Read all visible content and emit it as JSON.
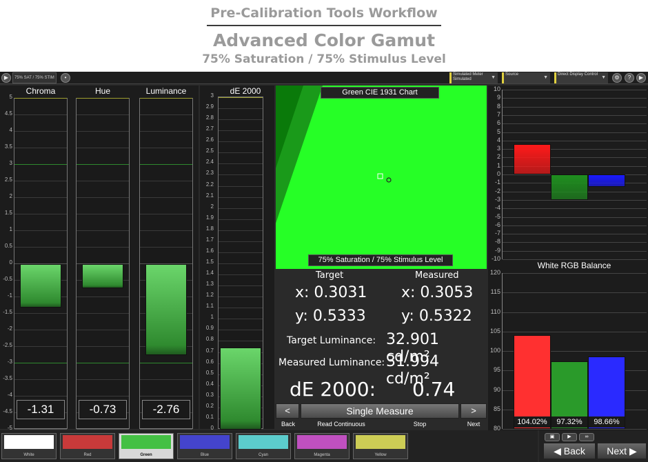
{
  "header": {
    "title": "Pre-Calibration Tools Workflow",
    "subtitle": "Advanced Color Gamut",
    "subtitle2": "75% Saturation / 75% Stimulus Level"
  },
  "toolbar": {
    "pattern_label": "75% SAT / 75% STIM",
    "meter_label": "Simulated Meter\nSimulated",
    "source_label": "Source",
    "display_label": "Direct Display Control"
  },
  "colors": {
    "accent_green": "#26ff26",
    "red": "#ff2a2a",
    "green": "#2f9a2f",
    "blue": "#2626ff"
  },
  "left_chart": {
    "ticks": [
      "5",
      "4.5",
      "4",
      "3.5",
      "3",
      "2.5",
      "2",
      "1.5",
      "1",
      "0.5",
      "0",
      "-0.5",
      "-1",
      "-1.5",
      "-2",
      "-2.5",
      "-3",
      "-3.5",
      "-4",
      "-4.5",
      "-5"
    ],
    "columns": [
      {
        "title": "Chroma",
        "value": -1.31,
        "label": "-1.31"
      },
      {
        "title": "Hue",
        "value": -0.73,
        "label": "-0.73"
      },
      {
        "title": "Luminance",
        "value": -2.76,
        "label": "-2.76"
      }
    ]
  },
  "de_chart": {
    "title": "dE 2000",
    "ticks": [
      "3",
      "2.9",
      "2.8",
      "2.7",
      "2.6",
      "2.5",
      "2.4",
      "2.3",
      "2.2",
      "2.1",
      "2",
      "1.9",
      "1.8",
      "1.7",
      "1.6",
      "1.5",
      "1.4",
      "1.3",
      "1.2",
      "1.1",
      "1",
      "0.9",
      "0.8",
      "0.7",
      "0.6",
      "0.5",
      "0.4",
      "0.3",
      "0.2",
      "0.1",
      "0"
    ],
    "value": 0.74
  },
  "cie": {
    "title": "Green CIE 1931 Chart",
    "caption": "75% Saturation / 75% Stimulus Level"
  },
  "readings": {
    "target_header": "Target",
    "measured_header": "Measured",
    "target_x": "x: 0.3031",
    "measured_x": "x: 0.3053",
    "target_y": "y: 0.5333",
    "measured_y": "y: 0.5322",
    "target_lum_label": "Target Luminance:",
    "target_lum_value": "32.901 cd/m²",
    "measured_lum_label": "Measured Luminance:",
    "measured_lum_value": "31.994 cd/m²",
    "de_label": "dE 2000:",
    "de_value": "0.74"
  },
  "controls": {
    "prev_symbol": "<",
    "next_symbol": ">",
    "single_measure": "Single Measure",
    "back": "Back",
    "read_continuous": "Read Continuous",
    "stop": "Stop",
    "next": "Next"
  },
  "rgb_chart": {
    "ticks": [
      "10",
      "9",
      "8",
      "7",
      "6",
      "5",
      "4",
      "3",
      "2",
      "1",
      "0",
      "-1",
      "-2",
      "-3",
      "-4",
      "-5",
      "-6",
      "-7",
      "-8",
      "-9",
      "-10"
    ],
    "values": {
      "red": 3.6,
      "green": -3.0,
      "blue": -1.5
    }
  },
  "balance_chart": {
    "title": "White RGB Balance",
    "ticks": [
      "120",
      "115",
      "110",
      "105",
      "100",
      "95",
      "90",
      "85",
      "80"
    ],
    "bars": [
      {
        "name": "red",
        "value": 104.02,
        "label": "104.02%"
      },
      {
        "name": "green",
        "value": 97.32,
        "label": "97.32%"
      },
      {
        "name": "blue",
        "value": 98.66,
        "label": "98.66%"
      }
    ]
  },
  "swatches": [
    {
      "label": "White",
      "color": "#ffffff"
    },
    {
      "label": "Red",
      "color": "#c83a3a"
    },
    {
      "label": "Green",
      "color": "#44c044",
      "selected": true
    },
    {
      "label": "Blue",
      "color": "#4444cc"
    },
    {
      "label": "Cyan",
      "color": "#5ccccc"
    },
    {
      "label": "Magenta",
      "color": "#c050c0"
    },
    {
      "label": "Yellow",
      "color": "#cccc55"
    }
  ],
  "bottom_nav": {
    "back": "Back",
    "next": "Next"
  }
}
